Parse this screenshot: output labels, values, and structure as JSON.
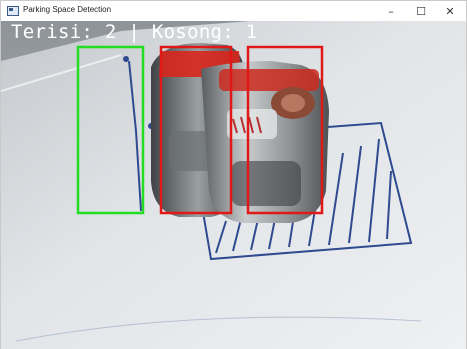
{
  "window": {
    "title": "Parking Space Detection",
    "controls": {
      "minimize": "–",
      "maximize": "☐",
      "close": "✕"
    }
  },
  "overlay": {
    "status_text": "Terisi: 2 | Kosong: 1",
    "occupied_count": 2,
    "empty_count": 1
  },
  "slots": [
    {
      "status": "empty",
      "color": "#22dd22"
    },
    {
      "status": "occupied",
      "color": "#e01818"
    },
    {
      "status": "occupied",
      "color": "#e01818"
    }
  ],
  "icons": {
    "app": "app-window-icon",
    "car": "toy-car"
  }
}
